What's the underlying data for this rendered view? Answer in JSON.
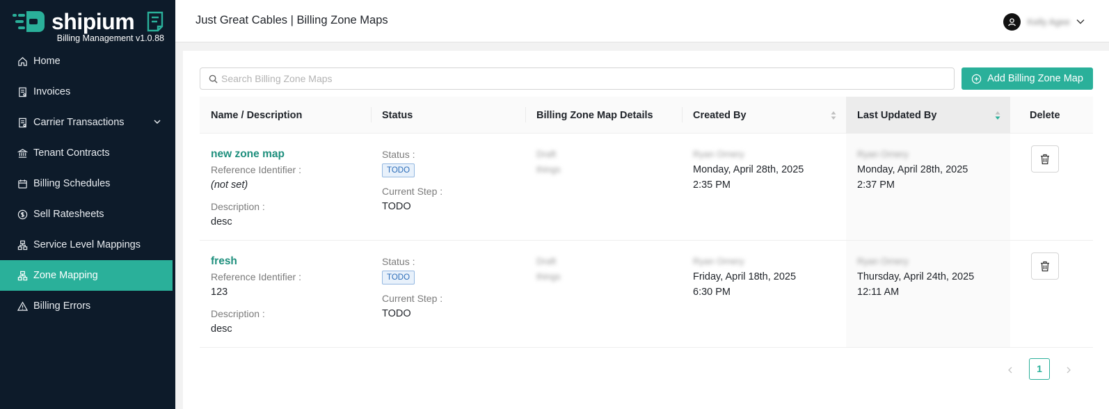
{
  "brand": {
    "name": "shipium",
    "version": "Billing Management v1.0.88"
  },
  "sidebar": {
    "items": [
      {
        "label": "Home",
        "icon": "home-icon"
      },
      {
        "label": "Invoices",
        "icon": "invoice-icon"
      },
      {
        "label": "Carrier Transactions",
        "icon": "transactions-icon",
        "expandable": true
      },
      {
        "label": "Tenant Contracts",
        "icon": "bank-icon"
      },
      {
        "label": "Billing Schedules",
        "icon": "calendar-icon"
      },
      {
        "label": "Sell Ratesheets",
        "icon": "dollar-icon"
      },
      {
        "label": "Service Level Mappings",
        "icon": "mapping-icon"
      },
      {
        "label": "Zone Mapping",
        "icon": "mapping-icon",
        "active": true
      },
      {
        "label": "Billing Errors",
        "icon": "warning-icon"
      }
    ]
  },
  "header": {
    "title": "Just Great Cables | Billing Zone Maps",
    "user_name": "Kelly Agee"
  },
  "search": {
    "placeholder": "Search Billing Zone Maps",
    "value": ""
  },
  "add_button": {
    "label": "Add Billing Zone Map"
  },
  "table": {
    "columns": [
      "Name / Description",
      "Status",
      "Billing Zone Map Details",
      "Created By",
      "Last Updated By",
      "Delete"
    ],
    "labels": {
      "ref": "Reference Identifier :",
      "desc": "Description :",
      "status": "Status :",
      "step": "Current Step :"
    },
    "rows": [
      {
        "name": "new zone map",
        "reference": "(not set)",
        "description": "desc",
        "status": "TODO",
        "current_step": "TODO",
        "details_line1": "Draft",
        "details_line2": "things",
        "created_by": "Ryan Ornery",
        "created_date": "Monday, April 28th, 2025",
        "created_time": "2:35 PM",
        "updated_by": "Ryan Ornery",
        "updated_date": "Monday, April 28th, 2025",
        "updated_time": "2:37 PM"
      },
      {
        "name": "fresh",
        "reference": "123",
        "description": "desc",
        "status": "TODO",
        "current_step": "TODO",
        "details_line1": "Draft",
        "details_line2": "things",
        "created_by": "Ryan Ornery",
        "created_date": "Friday, April 18th, 2025",
        "created_time": "6:30 PM",
        "updated_by": "Ryan Ornery",
        "updated_date": "Thursday, April 24th, 2025",
        "updated_time": "12:11 AM"
      }
    ]
  },
  "pagination": {
    "current_page": "1"
  },
  "colors": {
    "sidebar_bg": "#0d1b2a",
    "accent": "#2ab09a",
    "link": "#1e8f7d",
    "tag_blue": "#2b6cb8"
  }
}
